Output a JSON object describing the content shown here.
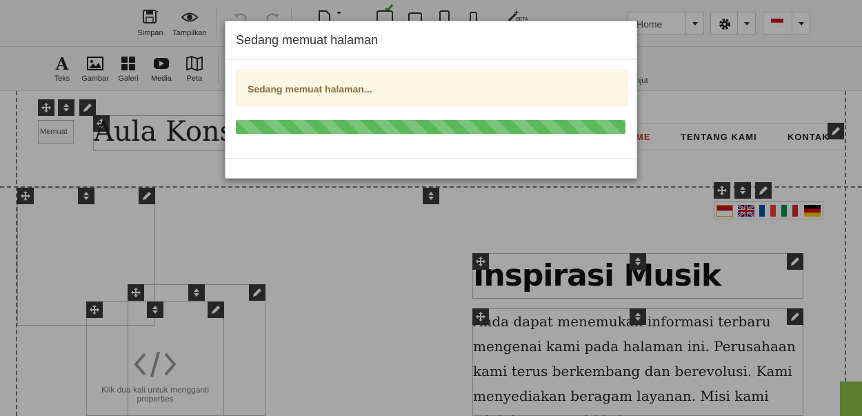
{
  "toolbar": {
    "save_label": "Simpan",
    "preview_label": "Tampilkan",
    "beta_label": "BETA",
    "page_select": {
      "value": "Home"
    },
    "colors": {
      "check": "#2e9e3e"
    }
  },
  "insert_bar": {
    "items": [
      {
        "label": "Teks",
        "icon": "text-icon"
      },
      {
        "label": "Gambar",
        "icon": "image-icon"
      },
      {
        "label": "Galeri",
        "icon": "gallery-icon"
      },
      {
        "label": "Media",
        "icon": "media-icon"
      },
      {
        "label": "Peta",
        "icon": "map-icon"
      }
    ],
    "partial_label": "njut"
  },
  "canvas": {
    "logo_placeholder": "Memuat",
    "site_title": "Aula Konse",
    "nav": {
      "home": "ME",
      "about": "TENTANG KAMI",
      "contact": "KONTAK"
    },
    "heading": "Inspirasi Musik",
    "paragraph": "Anda dapat menemukan informasi terbaru mengenai kami pada halaman ini. Perusahaan kami terus berkembang dan berevolusi. Kami menyediakan beragam layanan. Misi kami adalah memenuhi kebu...",
    "code_placeholder": "Klik dua kali untuk mengganti properties"
  },
  "modal": {
    "title": "Sedang memuat halaman",
    "alert": "Sedang memuat halaman...",
    "progress": 1.0,
    "colors": {
      "progress": "#5cb85c",
      "alert_bg": "#fcf8e3",
      "alert_text": "#8a6d3b"
    }
  }
}
